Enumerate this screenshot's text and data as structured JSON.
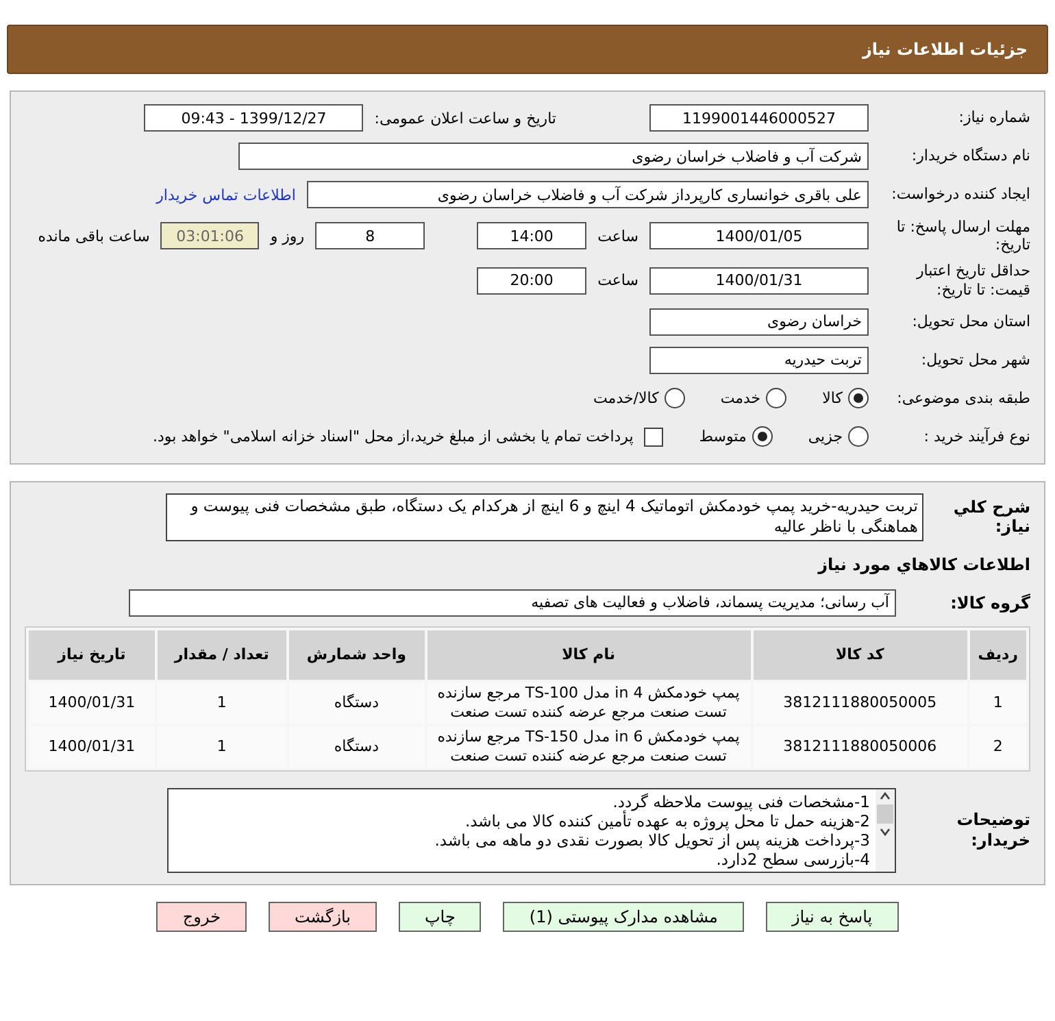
{
  "header": {
    "title": "جزئیات اطلاعات نیاز"
  },
  "need_number": {
    "label": "شماره نیاز:",
    "value": "1199001446000527"
  },
  "announce": {
    "label": "تاریخ و ساعت اعلان عمومی:",
    "value": "1399/12/27 - 09:43"
  },
  "buyer": {
    "label": "نام دستگاه خریدار:",
    "value": "شرکت آب و فاضلاب خراسان رضوی"
  },
  "creator": {
    "label": "ایجاد کننده درخواست:",
    "value": "علی باقری خوانساری کارپرداز شرکت آب و فاضلاب خراسان رضوی",
    "link": "اطلاعات تماس خریدار"
  },
  "deadline": {
    "label": "مهلت ارسال پاسخ: تا تاریخ:",
    "date": "1400/01/05",
    "time_label": "ساعت",
    "time": "14:00",
    "days": "8",
    "days_label": "روز و",
    "remaining": "03:01:06",
    "remaining_label": "ساعت باقی مانده"
  },
  "validity": {
    "label": "حداقل تاریخ اعتبار قیمت: تا تاریخ:",
    "date": "1400/01/31",
    "time_label": "ساعت",
    "time": "20:00"
  },
  "province": {
    "label": "استان محل تحویل:",
    "value": "خراسان رضوی"
  },
  "city": {
    "label": "شهر محل تحویل:",
    "value": "تربت حیدریه"
  },
  "category": {
    "label": "طبقه بندی موضوعی:",
    "options": [
      {
        "label": "کالا",
        "selected": true
      },
      {
        "label": "خدمت",
        "selected": false
      },
      {
        "label": "کالا/خدمت",
        "selected": false
      }
    ]
  },
  "purchase_type": {
    "label": "نوع فرآیند خرید :",
    "options": [
      {
        "label": "جزیی",
        "selected": false
      },
      {
        "label": "متوسط",
        "selected": true
      }
    ],
    "treasury": {
      "checked": false,
      "text": "پرداخت تمام یا بخشی از مبلغ خرید،از محل \"اسناد خزانه اسلامی\" خواهد بود."
    }
  },
  "description": {
    "label": "شرح کلي نياز:",
    "value": "تربت حیدریه-خرید پمپ خودمکش اتوماتیک 4 اینچ و 6 اینچ از هرکدام یک دستگاه، طبق مشخصات فنی پیوست و هماهنگی با ناظر عالیه"
  },
  "goods_title": "اطلاعات کالاهاي مورد نياز",
  "goods_group": {
    "label": "گروه کالا:",
    "value": "آب رسانی؛ مدیریت پسماند، فاضلاب و فعالیت های تصفیه"
  },
  "table": {
    "columns": [
      "ردیف",
      "کد کالا",
      "نام کالا",
      "واحد شمارش",
      "تعداد / مقدار",
      "تاریخ نیاز"
    ],
    "rows": [
      [
        "1",
        "3812111880050005",
        "پمپ خودمکش 4 in مدل TS-100 مرجع سازنده تست صنعت مرجع عرضه کننده تست صنعت",
        "دستگاه",
        "1",
        "1400/01/31"
      ],
      [
        "2",
        "3812111880050006",
        "پمپ خودمکش 6 in مدل TS-150 مرجع سازنده تست صنعت مرجع عرضه کننده تست صنعت",
        "دستگاه",
        "1",
        "1400/01/31"
      ]
    ]
  },
  "buyer_notes": {
    "label": "توضیحات خریدار:",
    "lines": [
      "1-مشخصات فنی پیوست ملاحظه گردد.",
      "2-هزینه حمل تا محل پروژه به عهده تأمین کننده کالا می باشد.",
      "3-پرداخت هزینه پس از تحویل کالا بصورت نقدی دو ماهه می باشد.",
      "4-بازرسی سطح 2دارد."
    ]
  },
  "buttons": [
    {
      "label": "پاسخ به نیاز",
      "kind": "normal"
    },
    {
      "label": "مشاهده مدارک پیوستی (1)",
      "kind": "normal"
    },
    {
      "label": "چاپ",
      "kind": "normal"
    },
    {
      "label": "بازگشت",
      "kind": "danger"
    },
    {
      "label": "خروج",
      "kind": "danger"
    }
  ]
}
